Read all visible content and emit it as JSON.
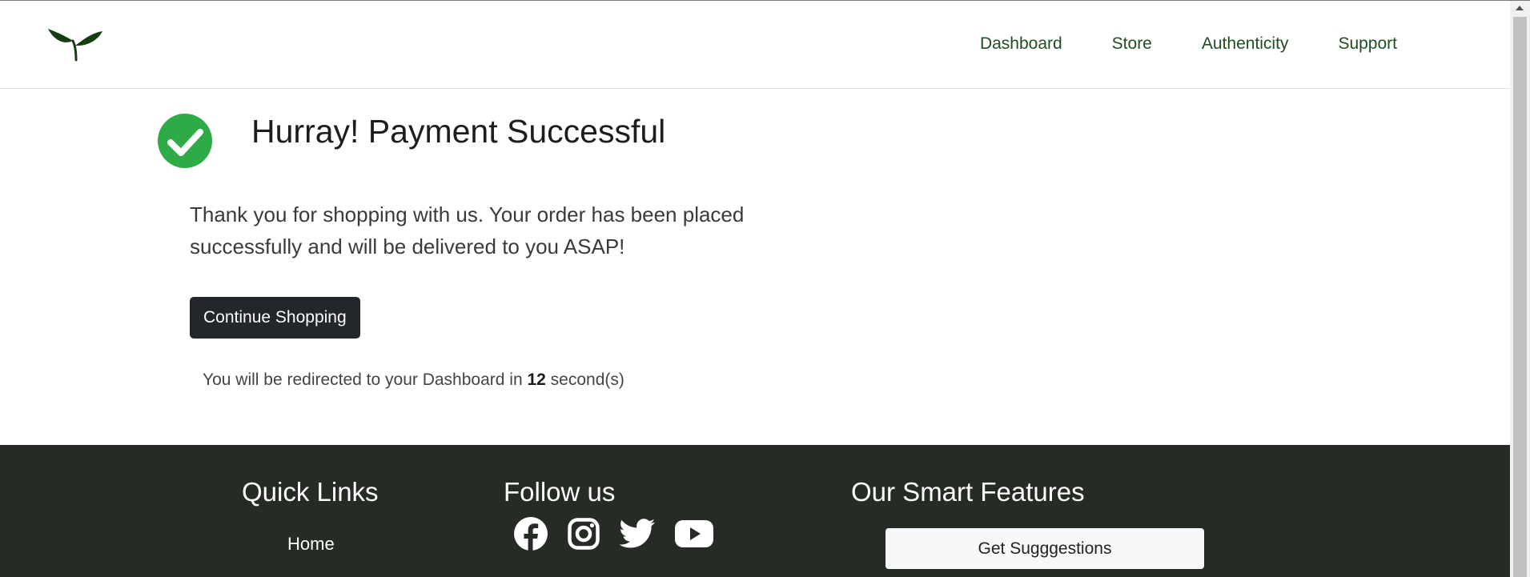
{
  "header": {
    "nav": [
      "Dashboard",
      "Store",
      "Authenticity",
      "Support"
    ]
  },
  "main": {
    "title": "Hurray! Payment Successful",
    "message": "Thank you for shopping with us. Your order has been placed successfully and will be delivered to you ASAP!",
    "continue_label": "Continue Shopping",
    "redirect_prefix": "You will be redirected to your Dashboard in ",
    "redirect_seconds": "12",
    "redirect_suffix": " second(s)"
  },
  "footer": {
    "quick_links_title": "Quick Links",
    "quick_links": [
      "Home"
    ],
    "follow_title": "Follow us",
    "social_icons": [
      "facebook-icon",
      "instagram-icon",
      "twitter-icon",
      "youtube-icon"
    ],
    "features_title": "Our Smart Features",
    "suggest_label": "Get Sugggestions"
  },
  "colors": {
    "nav_text": "#1f4d22",
    "success_green": "#2eaa47",
    "button_dark": "#23262b",
    "footer_bg": "#272b25"
  }
}
